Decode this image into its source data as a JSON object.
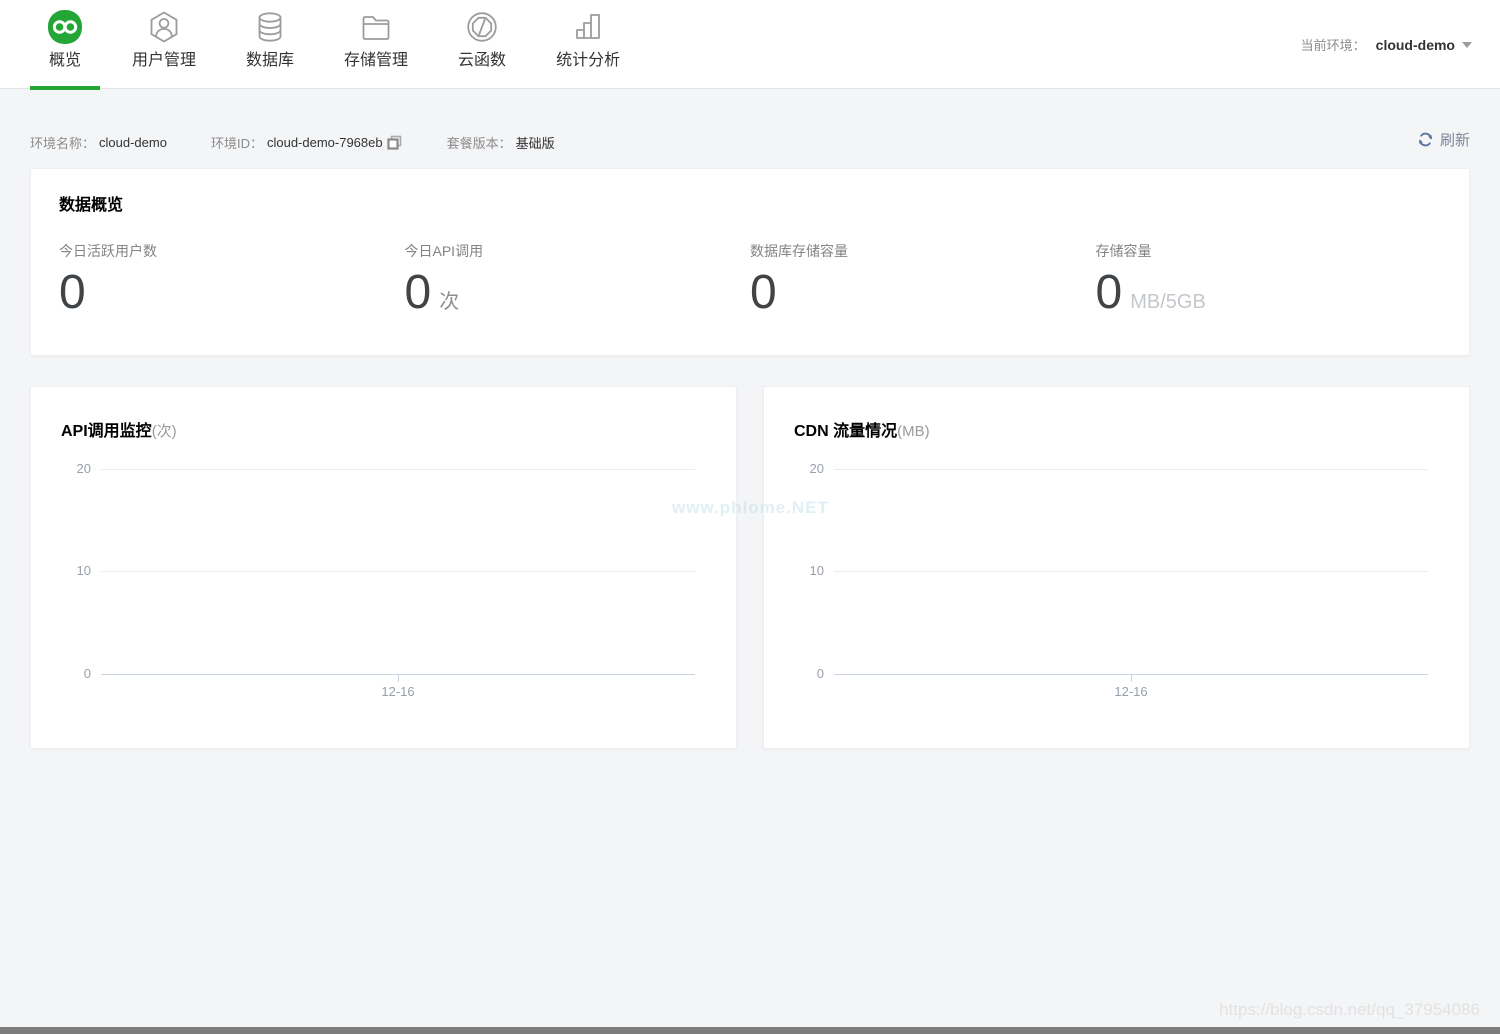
{
  "colors": {
    "accent_green": "#23a636",
    "refresh_blue": "#5b74a0"
  },
  "header": {
    "nav": [
      {
        "label": "概览",
        "icon": "infinity-icon",
        "active": true
      },
      {
        "label": "用户管理",
        "icon": "user-hexagon-icon",
        "active": false
      },
      {
        "label": "数据库",
        "icon": "database-icon",
        "active": false
      },
      {
        "label": "存储管理",
        "icon": "folder-icon",
        "active": false
      },
      {
        "label": "云函数",
        "icon": "cloud-function-icon",
        "active": false
      },
      {
        "label": "统计分析",
        "icon": "bar-chart-icon",
        "active": false
      }
    ],
    "env_selector": {
      "label": "当前环境：",
      "value": "cloud-demo"
    }
  },
  "env_bar": {
    "name_label": "环境名称：",
    "name_value": "cloud-demo",
    "id_label": "环境ID：",
    "id_value": "cloud-demo-7968eb",
    "plan_label": "套餐版本：",
    "plan_value": "基础版",
    "refresh_label": "刷新"
  },
  "overview": {
    "title": "数据概览",
    "metrics": [
      {
        "label": "今日活跃用户数",
        "value": "0",
        "unit": ""
      },
      {
        "label": "今日API调用",
        "value": "0",
        "unit": "次"
      },
      {
        "label": "数据库存储容量",
        "value": "0",
        "unit": ""
      },
      {
        "label": "存储容量",
        "value": "0",
        "unit": "MB/5GB"
      }
    ]
  },
  "charts": [
    {
      "title": "API调用监控",
      "title_suffix": "(次)",
      "y_ticks": {
        "top": "20",
        "mid": "10",
        "bottom": "0"
      },
      "x_tick": "12-16"
    },
    {
      "title": "CDN 流量情况",
      "title_suffix": "(MB)",
      "y_ticks": {
        "top": "20",
        "mid": "10",
        "bottom": "0"
      },
      "x_tick": "12-16"
    }
  ],
  "chart_data": [
    {
      "type": "line",
      "title": "API调用监控",
      "unit": "次",
      "x": [
        "12-16"
      ],
      "series": [],
      "ylim": [
        0,
        20
      ],
      "y_ticks": [
        0,
        10,
        20
      ],
      "grid": true,
      "legend": "none"
    },
    {
      "type": "line",
      "title": "CDN 流量情况",
      "unit": "MB",
      "x": [
        "12-16"
      ],
      "series": [],
      "ylim": [
        0,
        20
      ],
      "y_ticks": [
        0,
        10,
        20
      ],
      "grid": true,
      "legend": "none"
    }
  ],
  "watermarks": {
    "center_text": "www.phlome.NET",
    "bottom_text": "https://blog.csdn.net/qq_37954086"
  }
}
